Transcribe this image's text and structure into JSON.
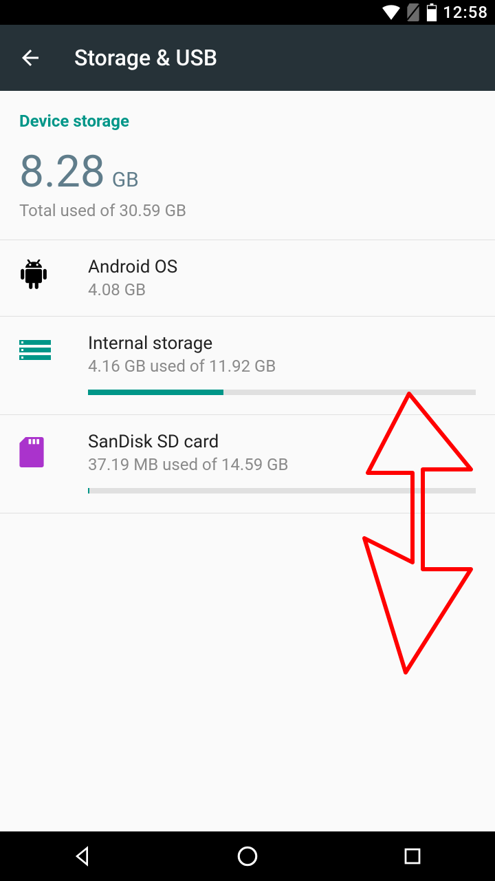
{
  "status": {
    "time": "12:58"
  },
  "appbar": {
    "title": "Storage & USB"
  },
  "section": {
    "title": "Device storage"
  },
  "summary": {
    "value": "8.28",
    "unit": "GB",
    "subtitle": "Total used of 30.59 GB"
  },
  "rows": {
    "os": {
      "title": "Android OS",
      "sub": "4.08 GB"
    },
    "internal": {
      "title": "Internal storage",
      "sub": "4.16 GB used of 11.92 GB",
      "progress_pct": 35
    },
    "sd": {
      "title": "SanDisk SD card",
      "sub": "37.19 MB used of 14.59 GB",
      "progress_pct": 0.3
    }
  },
  "colors": {
    "accent": "#009688",
    "annotation": "#ff0000"
  }
}
